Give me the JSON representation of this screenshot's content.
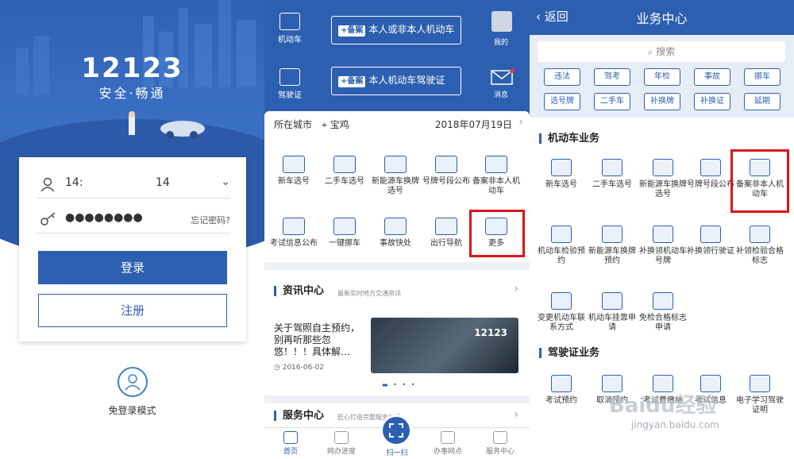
{
  "colors": {
    "brand_blue": "#2d5fb0",
    "highlight_red": "#d9161f"
  },
  "login": {
    "logo_number": "12123",
    "logo_slogan": "安全·畅通",
    "username_value_left": "14:",
    "username_value_right": "14",
    "password_value": "●●●●●●●●",
    "forgot_password": "忘记密码?",
    "login_button": "登录",
    "register_button": "注册",
    "guest_mode": "免登录模式",
    "icons": [
      "user-icon",
      "key-icon",
      "chevron-down-icon",
      "guest-user-icon"
    ]
  },
  "home": {
    "top_icons": {
      "vehicle": "机动车",
      "license": "驾驶证",
      "mine": "我的",
      "message": "消息"
    },
    "register_tag": "+备案",
    "register_vehicle": "本人或非本人机动车",
    "register_license": "本人机动车驾驶证",
    "city_label": "所在城市",
    "city_name": "宝鸡",
    "date": "2018年07月19日",
    "services": [
      "新车选号",
      "二手车选号",
      "新能源车换牌选号",
      "号牌号段公布",
      "备案非本人机动车",
      "考试信息公布",
      "一键挪车",
      "事故快处",
      "出行导航",
      "更多"
    ],
    "news_title": "资讯中心",
    "news_subtitle": "最新实时地方交通资讯",
    "news_text": "关于驾照自主预约，别再听那些忽悠！！！具体解…",
    "news_date": "2016-06-02",
    "news_image_logo": "12123",
    "service_center_title": "服务中心",
    "service_center_subtitle": "匠心打造完整服务体系",
    "tabs": [
      "首页",
      "网办进度",
      "扫一扫",
      "办事网点",
      "服务中心"
    ]
  },
  "business": {
    "back": "返回",
    "title": "业务中心",
    "search_placeholder": "搜索",
    "chips_row1": [
      "违法",
      "驾考",
      "年检",
      "事故",
      "挪车"
    ],
    "chips_row2": [
      "选号牌",
      "二手车",
      "补换牌",
      "补换证",
      "延期"
    ],
    "vehicle_section": "机动车业务",
    "vehicle_items": [
      "新车选号",
      "二手车选号",
      "新能源车换牌选号",
      "号牌号段公布",
      "备案非本人机动车",
      "机动车检验预约",
      "新能源车换牌预约",
      "补换领机动车号牌",
      "补换领行驶证",
      "补领检验合格标志",
      "变更机动车联系方式",
      "机动车挂靠申请",
      "免检合格标志申请"
    ],
    "license_section": "驾驶证业务",
    "license_items": [
      "考试预约",
      "取消预约",
      "考试费缴纳",
      "考试信息",
      "电子学习驾驶证明"
    ],
    "watermark": "Baidu经验",
    "watermark_url": "jingyan.baidu.com"
  }
}
